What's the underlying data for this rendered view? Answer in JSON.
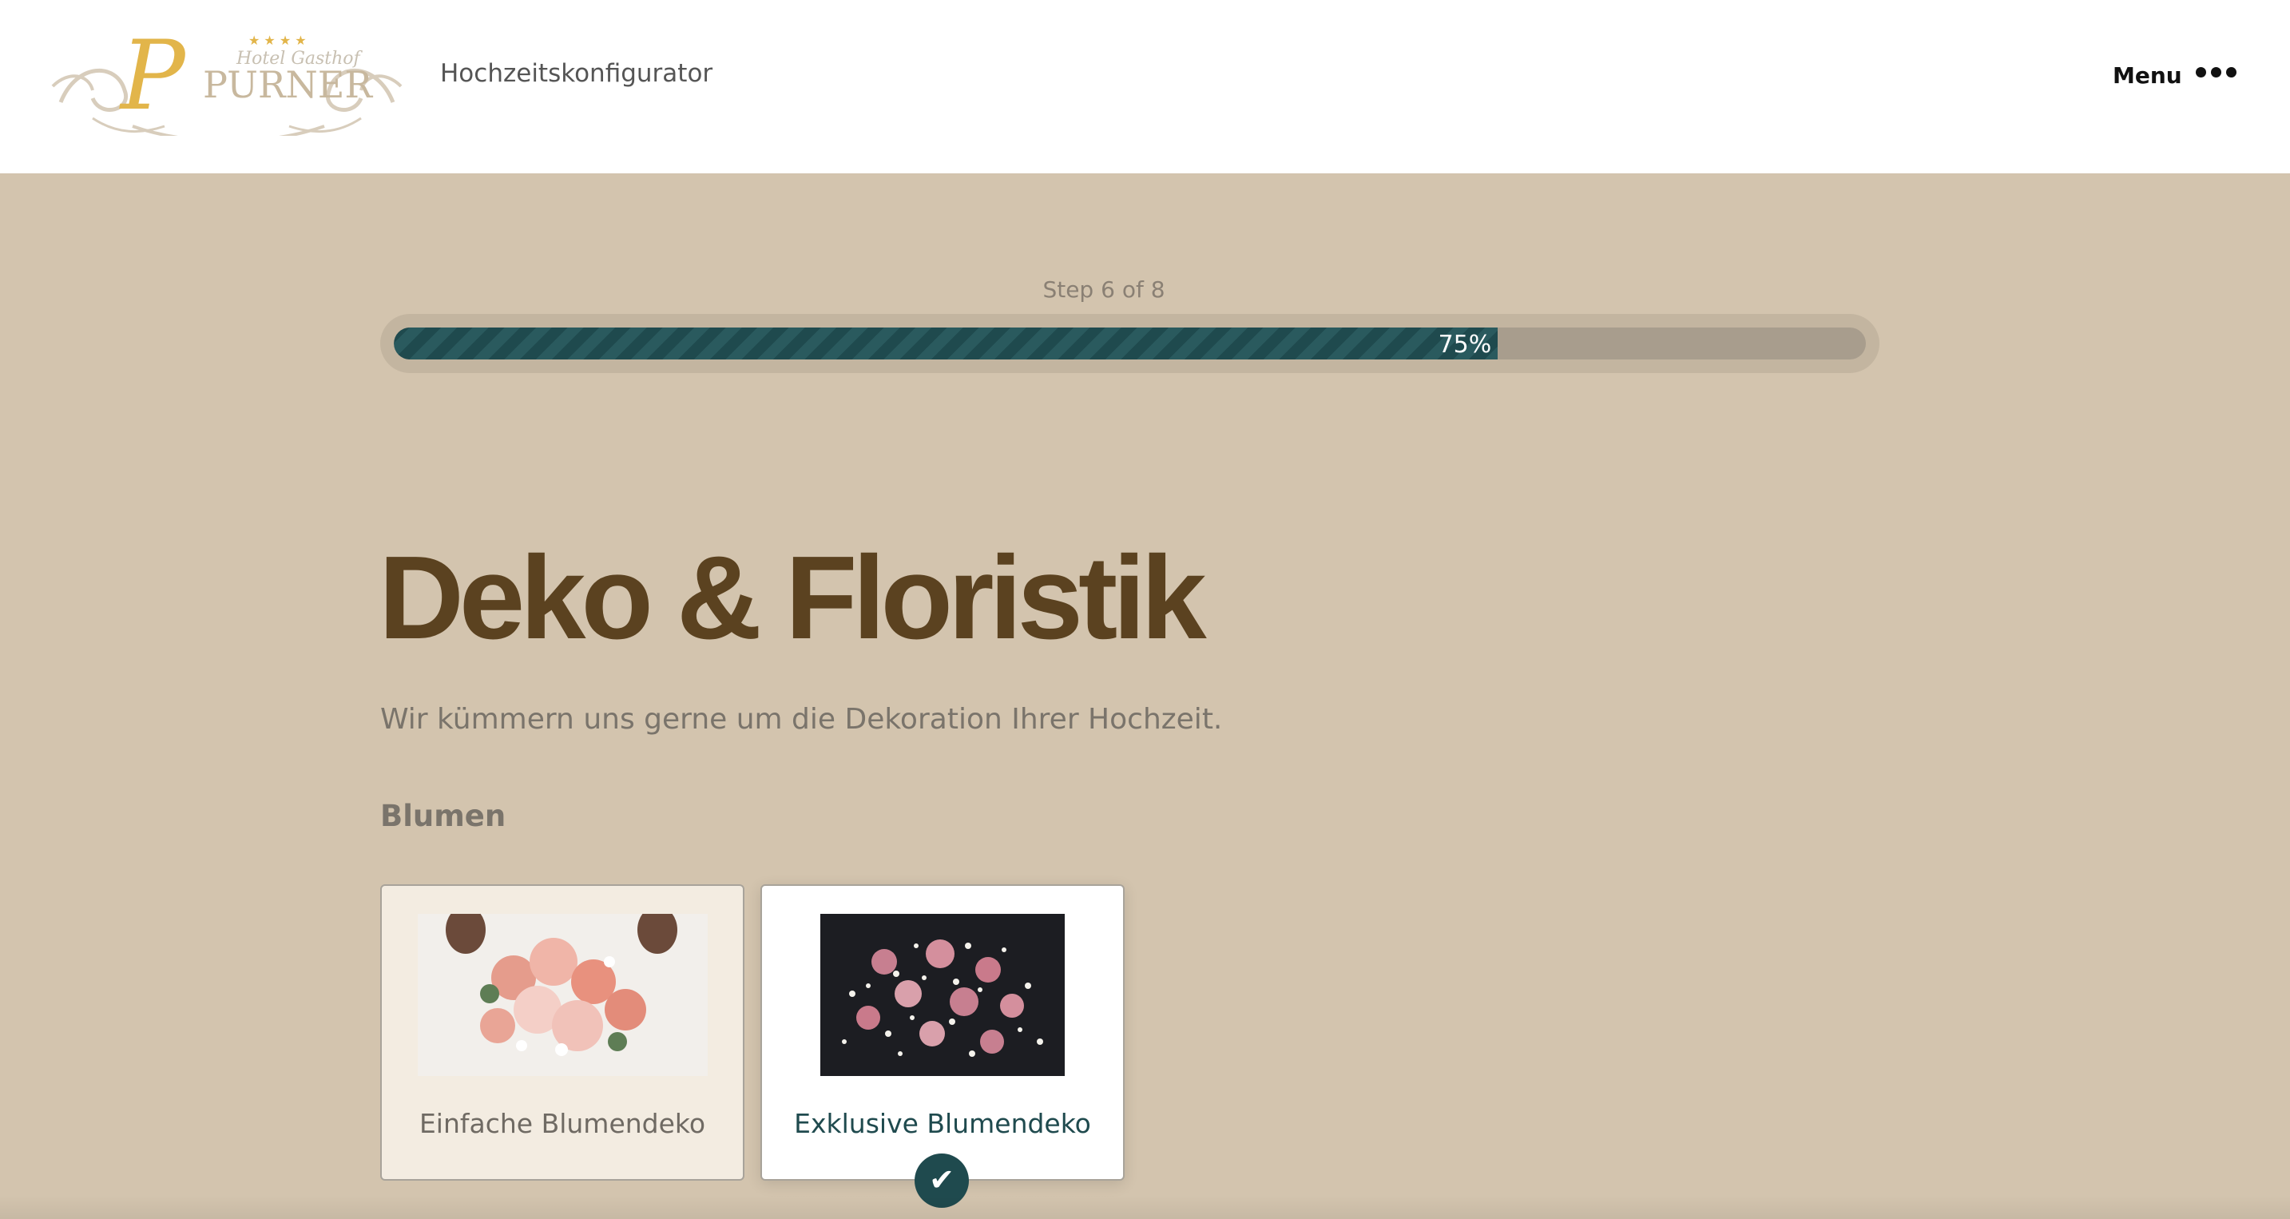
{
  "header": {
    "logo_alt": "Hotel Gasthof Purner",
    "logo_script": "Hotel Gasthof",
    "logo_name": "PURNER",
    "site_title": "Hochzeitskonfigurator",
    "menu_label": "Menu"
  },
  "progress": {
    "step_text": "Step 6 of 8",
    "percent_text": "75%",
    "fraction": 0.75
  },
  "content": {
    "title": "Deko & Floristik",
    "subtitle": "Wir kümmern uns gerne um die Dekoration Ihrer Hochzeit.",
    "section_label": "Blumen",
    "options": [
      {
        "label": "Einfache Blumendeko",
        "image": "bridal-bouquet-photo",
        "selected": false
      },
      {
        "label": "Exklusive Blumendeko",
        "image": "roses-gypsophila-photo",
        "selected": true
      }
    ]
  },
  "colors": {
    "background": "#d3c4ae",
    "accent": "#1f4a4e",
    "title": "#5b4220",
    "logo_gold": "#e2b54a"
  },
  "icons": {
    "menu": "more-dots-icon",
    "check": "checkmark-icon"
  }
}
